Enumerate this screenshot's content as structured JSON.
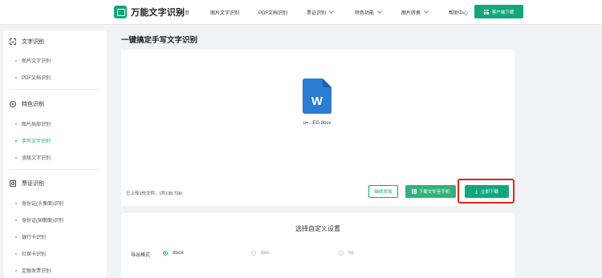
{
  "header": {
    "brand": "万能文字识别",
    "nav": [
      {
        "label": "首页",
        "has_dropdown": false
      },
      {
        "label": "图片文字识别",
        "has_dropdown": false
      },
      {
        "label": "PDF文档识别",
        "has_dropdown": false
      },
      {
        "label": "票证识别",
        "has_dropdown": true
      },
      {
        "label": "特色功能",
        "has_dropdown": true
      },
      {
        "label": "图片转换",
        "has_dropdown": true
      },
      {
        "label": "帮助中心",
        "has_dropdown": false
      }
    ],
    "download_button": "客户端下载"
  },
  "sidebar": {
    "sections": [
      {
        "title": "文字识别",
        "icon": "scan-text-icon",
        "items": [
          {
            "label": "图片文字识别",
            "active": false
          },
          {
            "label": "PDF文档识别",
            "active": false
          }
        ]
      },
      {
        "title": "特色识别",
        "icon": "feature-icon",
        "items": [
          {
            "label": "图片局部识别",
            "active": false
          },
          {
            "label": "手写文字识别",
            "active": true
          },
          {
            "label": "竖版文字识别",
            "active": false
          }
        ]
      },
      {
        "title": "票证识别",
        "icon": "id-card-icon",
        "items": [
          {
            "label": "身份证(头像面)识别",
            "active": false
          },
          {
            "label": "身份证(国徽面)识别",
            "active": false
          },
          {
            "label": "银行卡识别",
            "active": false
          },
          {
            "label": "社保卡识别",
            "active": false
          },
          {
            "label": "定额发票识别",
            "active": false
          }
        ]
      }
    ]
  },
  "main": {
    "title": "一键搞定手写文字识别",
    "file": {
      "icon_letter": "W",
      "name": "u=...EG.docx"
    },
    "upload_info": "已上传1份文件，(共138.72k)",
    "buttons": {
      "continue": "继续添加",
      "to_phone": "下载文件至手机",
      "download_now": "立即下载"
    },
    "settings": {
      "title": "选择自定义设置",
      "export_label": "导出格式",
      "formats": [
        {
          "label": "docx",
          "selected": true
        },
        {
          "label": "doc",
          "selected": false
        },
        {
          "label": "txt",
          "selected": false
        }
      ]
    }
  },
  "colors": {
    "accent": "#12a77a",
    "highlight": "#e1251b",
    "word_blue": "#2b7cd3"
  }
}
